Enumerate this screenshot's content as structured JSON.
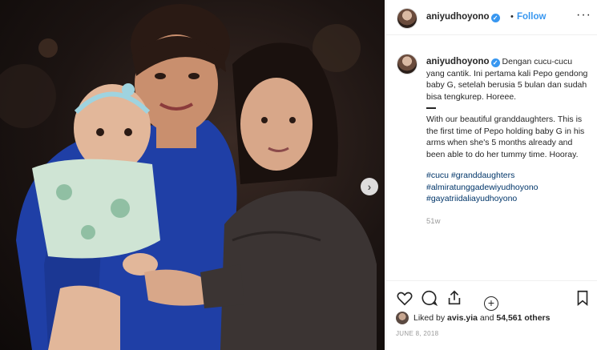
{
  "header": {
    "username": "aniyudhoyono",
    "separator": "•",
    "follow_label": "Follow",
    "more_label": "···"
  },
  "caption": {
    "username": "aniyudhoyono",
    "text_id": "Dengan cucu-cucu yang cantik. Ini pertama kali Pepo gendong baby G, setelah berusia 5 bulan dan sudah bisa tengkurep. Horeee.",
    "text_en": "With our beautiful granddaughters. This is the first time of Pepo holding baby G in his arms when she's 5 months already and been able to do her tummy time. Hooray.",
    "hashtags": [
      "#cucu #granddaughters",
      "#almiratunggadewiyudhoyono",
      "#gayatriidaliayudhoyono"
    ],
    "age": "51w"
  },
  "load_more_label": "+",
  "photo": {
    "next_label": "›"
  },
  "likes": {
    "prefix": "Liked by",
    "user": "avis.yia",
    "conjunction": "and",
    "count": "54,561 others"
  },
  "date": "JUNE 8, 2018",
  "colors": {
    "accent": "#3897f0",
    "hashtag": "#003569",
    "muted": "#999999"
  },
  "icons": [
    "heart-icon",
    "comment-icon",
    "share-icon",
    "bookmark-icon",
    "verified-icon",
    "chevron-right-icon",
    "plus-circle-icon"
  ]
}
